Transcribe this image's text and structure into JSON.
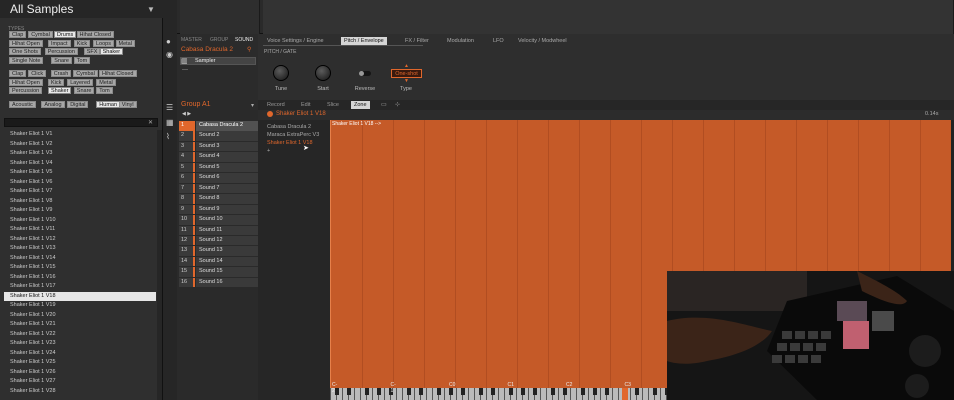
{
  "browser": {
    "title": "All Samples",
    "types_label": "TYPES",
    "tag_rows_1": [
      [
        "Clap",
        "Cymbal",
        "Drums",
        "Hihat Closed"
      ],
      [
        "Hihat Open",
        "Impact",
        "Kick",
        "Loops",
        "Metal"
      ],
      [
        "One Shots",
        "Percussion",
        "SFX",
        "Shaker"
      ],
      [
        "Single Note",
        "Snare",
        "Tom"
      ]
    ],
    "tag_rows_2": [
      [
        "Clap",
        "Click",
        "Crash",
        "Cymbal",
        "Hihat Closed"
      ],
      [
        "Hihat Open",
        "Kick",
        "Layered",
        "Metal"
      ],
      [
        "Percussion",
        "Shaker",
        "Snare",
        "Tom"
      ]
    ],
    "tag_rows_3": [
      [
        "Acoustic",
        "Analog",
        "Digital",
        "Human",
        "Vinyl"
      ]
    ],
    "selected_tags": [
      "Drums",
      "Shaker",
      "Human"
    ],
    "results": [
      "Shaker Eliot 1 V1",
      "Shaker Eliot 1 V2",
      "Shaker Eliot 1 V3",
      "Shaker Eliot 1 V4",
      "Shaker Eliot 1 V5",
      "Shaker Eliot 1 V6",
      "Shaker Eliot 1 V7",
      "Shaker Eliot 1 V8",
      "Shaker Eliot 1 V9",
      "Shaker Eliot 1 V10",
      "Shaker Eliot 1 V11",
      "Shaker Eliot 1 V12",
      "Shaker Eliot 1 V13",
      "Shaker Eliot 1 V14",
      "Shaker Eliot 1 V15",
      "Shaker Eliot 1 V16",
      "Shaker Eliot 1 V17",
      "Shaker Eliot 1 V18",
      "Shaker Eliot 1 V19",
      "Shaker Eliot 1 V20",
      "Shaker Eliot 1 V21",
      "Shaker Eliot 1 V22",
      "Shaker Eliot 1 V23",
      "Shaker Eliot 1 V24",
      "Shaker Eliot 1 V25",
      "Shaker Eliot 1 V26",
      "Shaker Eliot 1 V27",
      "Shaker Eliot 1 V28"
    ],
    "selected_result": "Shaker Eliot 1 V18"
  },
  "sound_header": {
    "tabs": [
      "MASTER",
      "GROUP",
      "SOUND"
    ],
    "sound_name": "Cabasa Dracula 2",
    "plugin_name": "Sampler",
    "plugin_sub": "—"
  },
  "params": {
    "tabs": [
      "Voice Settings / Engine",
      "Pitch / Envelope",
      "FX / Filter",
      "Modulation",
      "LFO",
      "Velocity / Modwheel"
    ],
    "active_tab": "Pitch / Envelope",
    "section_label": "PITCH / GATE",
    "controls": {
      "tune": "Tune",
      "start": "Start",
      "reverse": "Reverse",
      "type": "Type",
      "type_value": "One-shot"
    }
  },
  "group": {
    "title": "Group A1",
    "sounds": [
      "Cabasa Dracula 2",
      "Sound 2",
      "Sound 3",
      "Sound 4",
      "Sound 5",
      "Sound 6",
      "Sound 7",
      "Sound 8",
      "Sound 9",
      "Sound 10",
      "Sound 11",
      "Sound 12",
      "Sound 13",
      "Sound 14",
      "Sound 15",
      "Sound 16"
    ],
    "selected_index": 0
  },
  "editor": {
    "tabs": [
      "Record",
      "Edit",
      "Slice",
      "Zone"
    ],
    "active_tab": "Zone",
    "zone_title": "Shaker Eliot 1 V18",
    "zone_time": "0.14s",
    "samples": [
      "Cabasa Dracula 2",
      "Maraca ExtraPerc V3",
      "Shaker Eliot 1 V18",
      "+"
    ],
    "selected_sample": "Shaker Eliot 1 V18",
    "zone_label": "Shaker Eliot 1 V18 -->",
    "key_labels": [
      "C-2",
      "C-1",
      "C0",
      "C1",
      "C2",
      "C3"
    ]
  },
  "colors": {
    "accent": "#e0672c",
    "zone": "#c55a28"
  }
}
